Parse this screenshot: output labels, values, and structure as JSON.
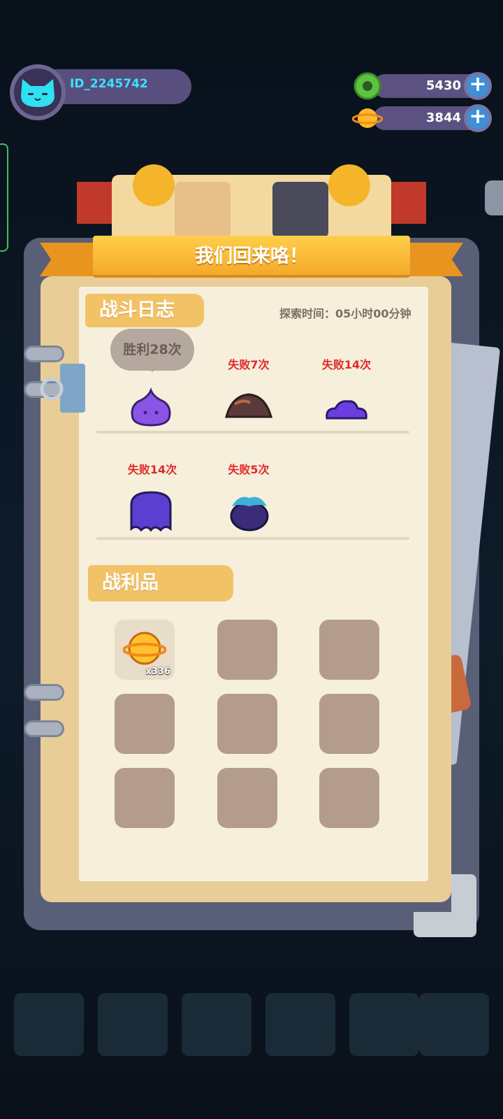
{
  "player": {
    "id": "ID_2245742",
    "avatar_icon": "cat-icon"
  },
  "currencies": [
    {
      "name": "donut-coin",
      "icon": "green-donut-icon",
      "value": "5430"
    },
    {
      "name": "planet-coin",
      "icon": "gold-planet-icon",
      "value": "3844"
    }
  ],
  "banner": {
    "title": "我们回来咯！"
  },
  "battle_log": {
    "heading": "战斗日志",
    "explore_time": "探索时间：05小时00分钟",
    "entries": [
      {
        "result": "胜利28次",
        "enemy_icon": "purple-slime-icon",
        "won": true
      },
      {
        "result": "失败7次",
        "enemy_icon": "rock-mound-icon",
        "won": false
      },
      {
        "result": "失败14次",
        "enemy_icon": "flat-slime-icon",
        "won": false
      },
      {
        "result": "失败14次",
        "enemy_icon": "purple-ghost-icon",
        "won": false
      },
      {
        "result": "失败5次",
        "enemy_icon": "blue-spiky-monster-icon",
        "won": false
      }
    ]
  },
  "loot": {
    "heading": "战利品",
    "items": [
      {
        "icon": "gold-planet-icon",
        "quantity": "x336"
      }
    ],
    "empty_slot_count": 8
  },
  "colors": {
    "win": "#b4a89f",
    "loss": "#e02a2a",
    "ribbon": "#f4a92a",
    "tag": "#f2c266"
  }
}
